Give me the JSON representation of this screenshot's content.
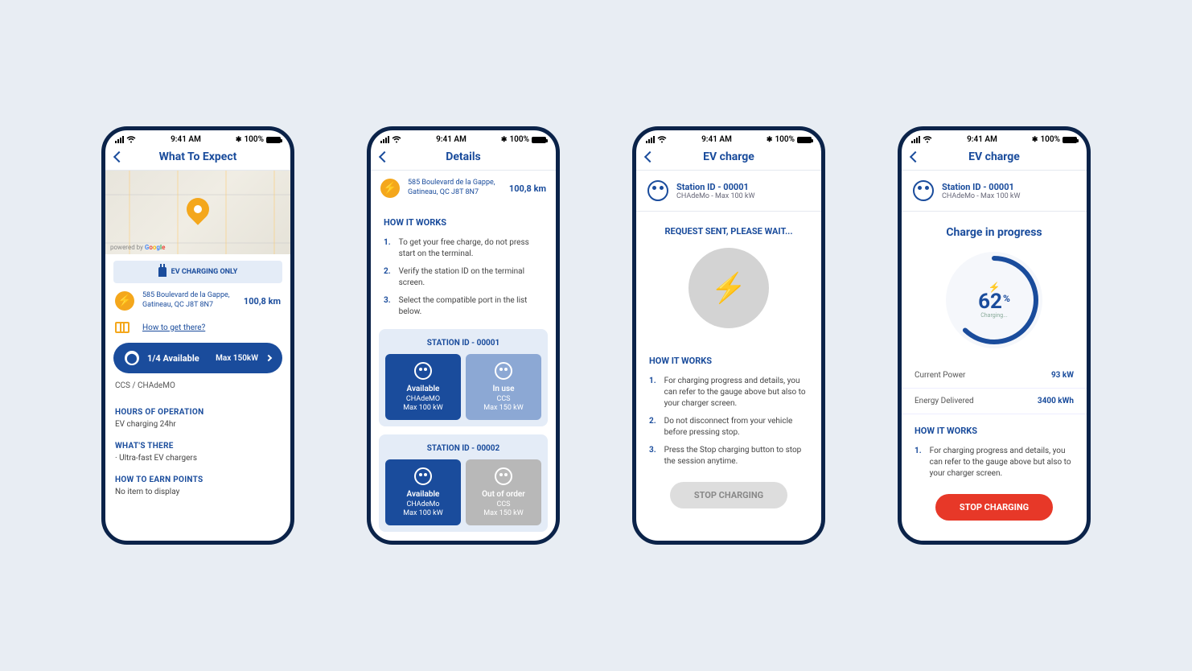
{
  "status_bar": {
    "time": "9:41 AM",
    "battery": "100%"
  },
  "screen1": {
    "title": "What To Expect",
    "powered_by": "powered by",
    "google": "Google",
    "banner": "EV CHARGING ONLY",
    "address": "585 Boulevard de la Gappe, Gatineau, QC J8T 8N7",
    "distance": "100,8 km",
    "directions": "How to get there?",
    "availability": "1/4 Available",
    "max_power": "Max 150kW",
    "plug_types": "CCS / CHAdeMO",
    "hours_title": "HOURS OF OPERATION",
    "hours_text": "EV charging 24hr",
    "whats_title": "WHAT'S THERE",
    "whats_text": "· Ultra-fast EV chargers",
    "points_title": "HOW TO EARN POINTS",
    "points_text": "No item to display"
  },
  "screen2": {
    "title": "Details",
    "address": "585 Boulevard de la Gappe, Gatineau, QC J8T 8N7",
    "distance": "100,8 km",
    "how_title": "HOW IT WORKS",
    "steps": [
      "To get your free charge, do not press start on the terminal.",
      "Verify the station ID on the terminal screen.",
      "Select the compatible port in the list below."
    ],
    "stations": [
      {
        "id": "STATION ID - 00001",
        "ports": [
          {
            "status": "Available",
            "type": "CHAdeMO",
            "max": "Max 100 kW",
            "state": "available"
          },
          {
            "status": "In use",
            "type": "CCS",
            "max": "Max 150 kW",
            "state": "inuse"
          }
        ]
      },
      {
        "id": "STATION ID - 00002",
        "ports": [
          {
            "status": "Available",
            "type": "CHAdeMo",
            "max": "Max 100 kW",
            "state": "available"
          },
          {
            "status": "Out of order",
            "type": "CCS",
            "max": "Max 150 kW",
            "state": "outorder"
          }
        ]
      }
    ]
  },
  "screen3": {
    "title": "EV charge",
    "station_id": "Station ID - 00001",
    "station_sub": "CHAdeMo - Max 100 kW",
    "wait_msg": "REQUEST SENT, PLEASE WAIT...",
    "how_title": "HOW IT WORKS",
    "steps": [
      "For charging progress and details, you can refer to the gauge above but also to your charger screen.",
      "Do not disconnect from your vehicle before pressing stop.",
      "Press the Stop charging button to stop the session anytime."
    ],
    "stop_btn": "STOP CHARGING"
  },
  "screen4": {
    "title": "EV charge",
    "station_id": "Station ID - 00001",
    "station_sub": "CHAdeMo - Max 100 kW",
    "progress_title": "Charge in progress",
    "percent": "62",
    "percent_label": "Charging...",
    "stats": [
      {
        "label": "Current Power",
        "value": "93 kW"
      },
      {
        "label": "Energy Delivered",
        "value": "3400 kWh"
      }
    ],
    "how_title": "HOW IT WORKS",
    "steps": [
      "For charging progress and details, you can refer to the gauge above but also to your charger screen."
    ],
    "stop_btn": "STOP CHARGING"
  }
}
